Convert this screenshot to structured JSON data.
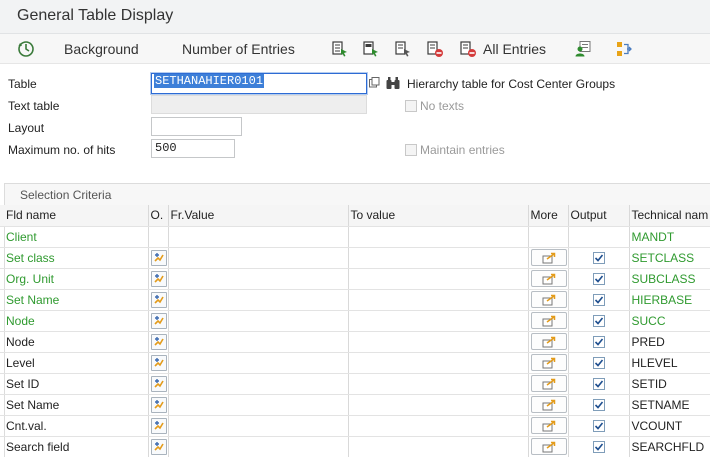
{
  "window": {
    "title": "General Table Display"
  },
  "toolbar": {
    "background_label": "Background",
    "number_of_entries_label": "Number of Entries",
    "all_entries_label": "All Entries"
  },
  "form": {
    "table": {
      "label": "Table",
      "value": "SETHANAHIER0101",
      "description": "Hierarchy table for Cost Center Groups"
    },
    "text_table": {
      "label": "Text table",
      "value": "",
      "no_texts_label": "No texts"
    },
    "layout": {
      "label": "Layout",
      "value": ""
    },
    "max_hits": {
      "label": "Maximum no. of hits",
      "value": "500",
      "maintain_entries_label": "Maintain entries"
    }
  },
  "selection": {
    "title": "Selection Criteria",
    "columns": {
      "fld_name": "Fld name",
      "option": "O.",
      "from_value": "Fr.Value",
      "to_value": "To value",
      "more": "More",
      "output": "Output",
      "technical_name": "Technical nam"
    },
    "rows": [
      {
        "fld": "Client",
        "tech": "MANDT",
        "key": true,
        "controls": false
      },
      {
        "fld": "Set class",
        "tech": "SETCLASS",
        "key": true,
        "controls": true
      },
      {
        "fld": "Org. Unit",
        "tech": "SUBCLASS",
        "key": true,
        "controls": true
      },
      {
        "fld": "Set Name",
        "tech": "HIERBASE",
        "key": true,
        "controls": true
      },
      {
        "fld": "Node",
        "tech": "SUCC",
        "key": true,
        "controls": true
      },
      {
        "fld": "Node",
        "tech": "PRED",
        "key": false,
        "controls": true
      },
      {
        "fld": "Level",
        "tech": "HLEVEL",
        "key": false,
        "controls": true
      },
      {
        "fld": "Set ID",
        "tech": "SETID",
        "key": false,
        "controls": true
      },
      {
        "fld": "Set Name",
        "tech": "SETNAME",
        "key": false,
        "controls": true
      },
      {
        "fld": "Cnt.val.",
        "tech": "VCOUNT",
        "key": false,
        "controls": true
      },
      {
        "fld": "Search field",
        "tech": "SEARCHFLD",
        "key": false,
        "controls": true
      }
    ]
  },
  "colors": {
    "key_field": "#2f9a2f",
    "focus": "#2d6bd4",
    "selection": "#3d7fd8"
  }
}
